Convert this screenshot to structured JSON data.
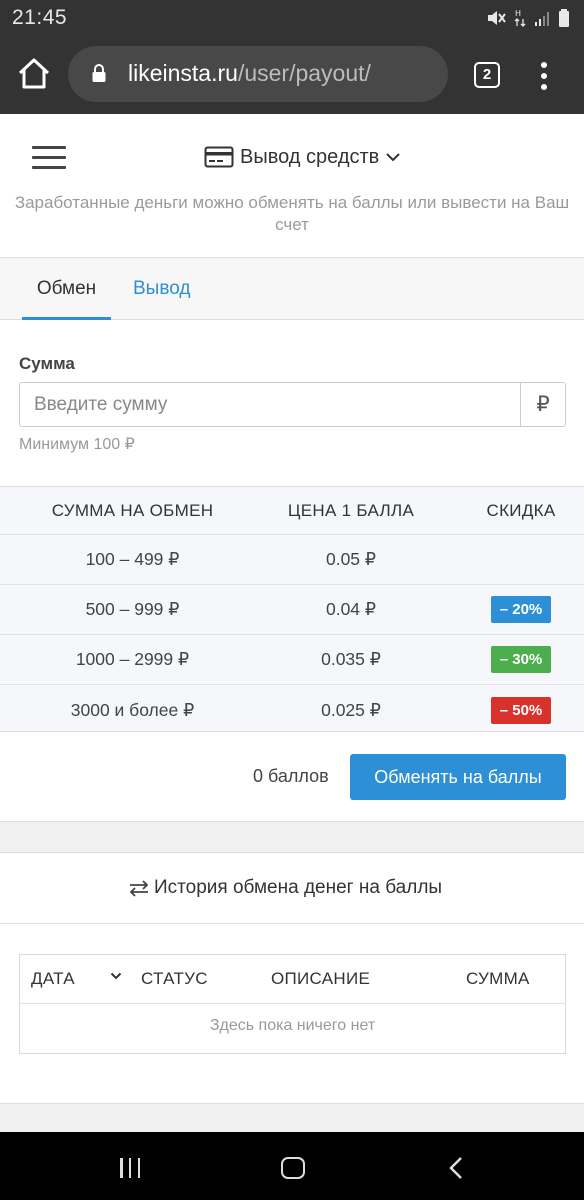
{
  "statusbar": {
    "time": "21:45"
  },
  "browser": {
    "url_domain": "likeinsta.ru",
    "url_path": "/user/payout/",
    "tab_count": "2"
  },
  "header": {
    "title": "Вывод средств"
  },
  "subtitle": "Заработанные деньги можно обменять на баллы или вывести на Ваш счет",
  "tabs": [
    {
      "label": "Обмен",
      "active": true
    },
    {
      "label": "Вывод",
      "active": false
    }
  ],
  "form": {
    "label": "Сумма",
    "placeholder": "Введите сумму",
    "value": "",
    "currency": "₽",
    "hint": "Минимум 100 ₽"
  },
  "price_table": {
    "headers": [
      "СУММА НА ОБМЕН",
      "ЦЕНА 1 БАЛЛА",
      "СКИДКА"
    ],
    "rows": [
      {
        "range": "100 – 499 ₽",
        "price": "0.05 ₽",
        "discount": "",
        "color": ""
      },
      {
        "range": "500 – 999 ₽",
        "price": "0.04 ₽",
        "discount": "– 20%",
        "color": "#2d8fd5"
      },
      {
        "range": "1000 – 2999 ₽",
        "price": "0.035 ₽",
        "discount": "– 30%",
        "color": "#4cae4c"
      },
      {
        "range": "3000 и более ₽",
        "price": "0.025 ₽",
        "discount": "– 50%",
        "color": "#d9312b"
      }
    ]
  },
  "action": {
    "points": "0 баллов",
    "button_label": "Обменять на баллы"
  },
  "history": {
    "title": "История обмена денег на баллы",
    "columns": [
      "ДАТА",
      "СТАТУС",
      "ОПИСАНИЕ",
      "СУММА"
    ],
    "empty_text": "Здесь пока ничего нет"
  },
  "colors": {
    "accent": "#2d8fd5",
    "chrome": "#333333"
  }
}
